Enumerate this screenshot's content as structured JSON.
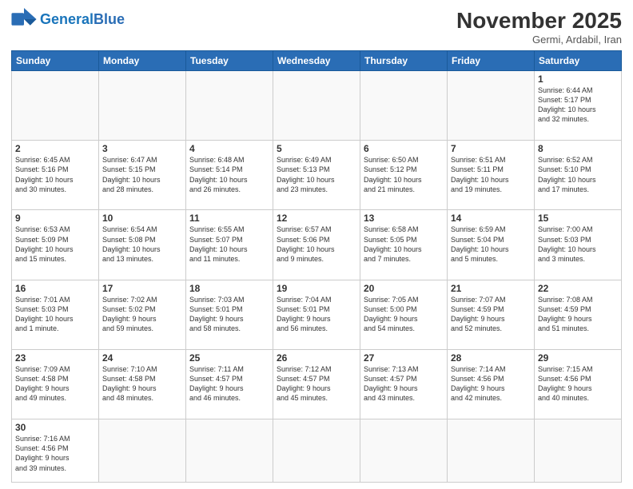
{
  "header": {
    "logo_general": "General",
    "logo_blue": "Blue",
    "month_title": "November 2025",
    "location": "Germi, Ardabil, Iran"
  },
  "days_of_week": [
    "Sunday",
    "Monday",
    "Tuesday",
    "Wednesday",
    "Thursday",
    "Friday",
    "Saturday"
  ],
  "weeks": [
    [
      {
        "day": "",
        "info": ""
      },
      {
        "day": "",
        "info": ""
      },
      {
        "day": "",
        "info": ""
      },
      {
        "day": "",
        "info": ""
      },
      {
        "day": "",
        "info": ""
      },
      {
        "day": "",
        "info": ""
      },
      {
        "day": "1",
        "info": "Sunrise: 6:44 AM\nSunset: 5:17 PM\nDaylight: 10 hours\nand 32 minutes."
      }
    ],
    [
      {
        "day": "2",
        "info": "Sunrise: 6:45 AM\nSunset: 5:16 PM\nDaylight: 10 hours\nand 30 minutes."
      },
      {
        "day": "3",
        "info": "Sunrise: 6:47 AM\nSunset: 5:15 PM\nDaylight: 10 hours\nand 28 minutes."
      },
      {
        "day": "4",
        "info": "Sunrise: 6:48 AM\nSunset: 5:14 PM\nDaylight: 10 hours\nand 26 minutes."
      },
      {
        "day": "5",
        "info": "Sunrise: 6:49 AM\nSunset: 5:13 PM\nDaylight: 10 hours\nand 23 minutes."
      },
      {
        "day": "6",
        "info": "Sunrise: 6:50 AM\nSunset: 5:12 PM\nDaylight: 10 hours\nand 21 minutes."
      },
      {
        "day": "7",
        "info": "Sunrise: 6:51 AM\nSunset: 5:11 PM\nDaylight: 10 hours\nand 19 minutes."
      },
      {
        "day": "8",
        "info": "Sunrise: 6:52 AM\nSunset: 5:10 PM\nDaylight: 10 hours\nand 17 minutes."
      }
    ],
    [
      {
        "day": "9",
        "info": "Sunrise: 6:53 AM\nSunset: 5:09 PM\nDaylight: 10 hours\nand 15 minutes."
      },
      {
        "day": "10",
        "info": "Sunrise: 6:54 AM\nSunset: 5:08 PM\nDaylight: 10 hours\nand 13 minutes."
      },
      {
        "day": "11",
        "info": "Sunrise: 6:55 AM\nSunset: 5:07 PM\nDaylight: 10 hours\nand 11 minutes."
      },
      {
        "day": "12",
        "info": "Sunrise: 6:57 AM\nSunset: 5:06 PM\nDaylight: 10 hours\nand 9 minutes."
      },
      {
        "day": "13",
        "info": "Sunrise: 6:58 AM\nSunset: 5:05 PM\nDaylight: 10 hours\nand 7 minutes."
      },
      {
        "day": "14",
        "info": "Sunrise: 6:59 AM\nSunset: 5:04 PM\nDaylight: 10 hours\nand 5 minutes."
      },
      {
        "day": "15",
        "info": "Sunrise: 7:00 AM\nSunset: 5:03 PM\nDaylight: 10 hours\nand 3 minutes."
      }
    ],
    [
      {
        "day": "16",
        "info": "Sunrise: 7:01 AM\nSunset: 5:03 PM\nDaylight: 10 hours\nand 1 minute."
      },
      {
        "day": "17",
        "info": "Sunrise: 7:02 AM\nSunset: 5:02 PM\nDaylight: 9 hours\nand 59 minutes."
      },
      {
        "day": "18",
        "info": "Sunrise: 7:03 AM\nSunset: 5:01 PM\nDaylight: 9 hours\nand 58 minutes."
      },
      {
        "day": "19",
        "info": "Sunrise: 7:04 AM\nSunset: 5:01 PM\nDaylight: 9 hours\nand 56 minutes."
      },
      {
        "day": "20",
        "info": "Sunrise: 7:05 AM\nSunset: 5:00 PM\nDaylight: 9 hours\nand 54 minutes."
      },
      {
        "day": "21",
        "info": "Sunrise: 7:07 AM\nSunset: 4:59 PM\nDaylight: 9 hours\nand 52 minutes."
      },
      {
        "day": "22",
        "info": "Sunrise: 7:08 AM\nSunset: 4:59 PM\nDaylight: 9 hours\nand 51 minutes."
      }
    ],
    [
      {
        "day": "23",
        "info": "Sunrise: 7:09 AM\nSunset: 4:58 PM\nDaylight: 9 hours\nand 49 minutes."
      },
      {
        "day": "24",
        "info": "Sunrise: 7:10 AM\nSunset: 4:58 PM\nDaylight: 9 hours\nand 48 minutes."
      },
      {
        "day": "25",
        "info": "Sunrise: 7:11 AM\nSunset: 4:57 PM\nDaylight: 9 hours\nand 46 minutes."
      },
      {
        "day": "26",
        "info": "Sunrise: 7:12 AM\nSunset: 4:57 PM\nDaylight: 9 hours\nand 45 minutes."
      },
      {
        "day": "27",
        "info": "Sunrise: 7:13 AM\nSunset: 4:57 PM\nDaylight: 9 hours\nand 43 minutes."
      },
      {
        "day": "28",
        "info": "Sunrise: 7:14 AM\nSunset: 4:56 PM\nDaylight: 9 hours\nand 42 minutes."
      },
      {
        "day": "29",
        "info": "Sunrise: 7:15 AM\nSunset: 4:56 PM\nDaylight: 9 hours\nand 40 minutes."
      }
    ],
    [
      {
        "day": "30",
        "info": "Sunrise: 7:16 AM\nSunset: 4:56 PM\nDaylight: 9 hours\nand 39 minutes."
      },
      {
        "day": "",
        "info": ""
      },
      {
        "day": "",
        "info": ""
      },
      {
        "day": "",
        "info": ""
      },
      {
        "day": "",
        "info": ""
      },
      {
        "day": "",
        "info": ""
      },
      {
        "day": "",
        "info": ""
      }
    ]
  ]
}
